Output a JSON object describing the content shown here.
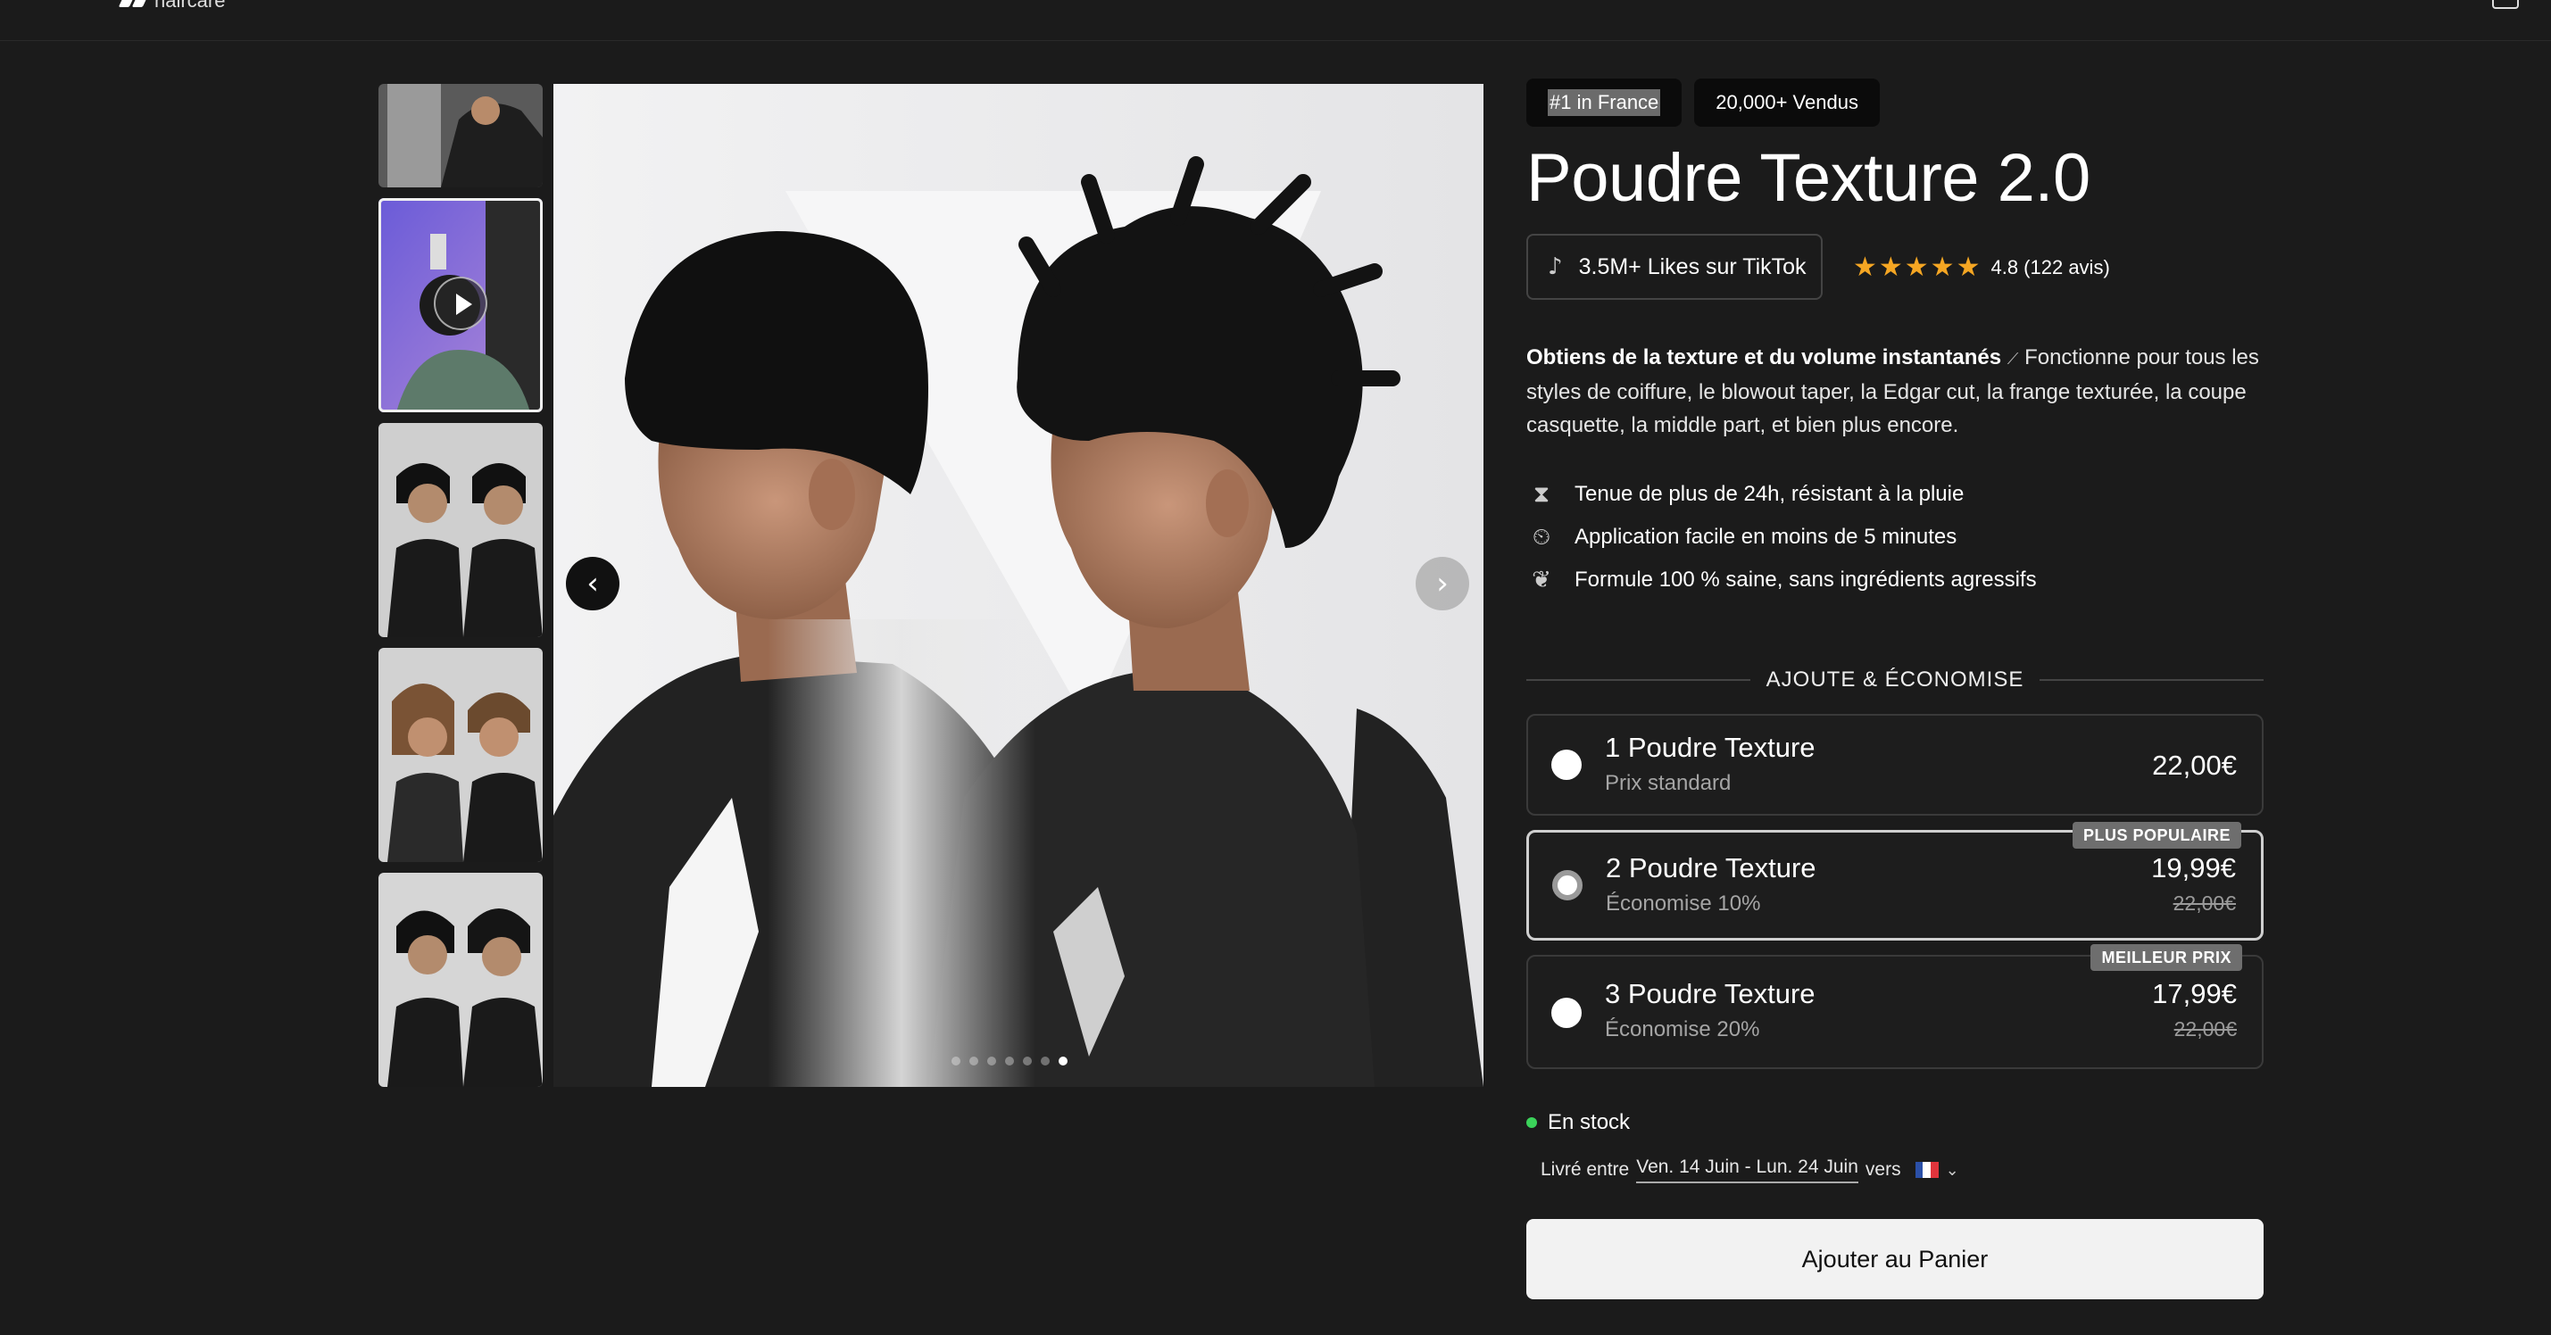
{
  "header": {
    "logo_text": "haircare"
  },
  "gallery": {
    "prev_icon": "chevron-left-icon",
    "next_icon": "chevron-right-icon",
    "dots_count": 7,
    "active_dot": 6
  },
  "product": {
    "badges": [
      "#1 in France",
      "20,000+ Vendus"
    ],
    "title": "Poudre Texture 2.0",
    "tiktok_label": "3.5M+ Likes sur TikTok",
    "rating_value": "4.8 (122 avis)",
    "stars": "★★★★★",
    "description_bold": "Obtiens de la texture et du volume instantanés",
    "description_rest": " Fonctionne pour tous les styles de coiffure, le blowout taper, la Edgar cut, la frange texturée, la coupe casquette, la middle part, et bien plus encore.",
    "features": [
      {
        "icon": "hourglass-icon",
        "text": "Tenue de plus de 24h, résistant à la pluie"
      },
      {
        "icon": "fast-clock-icon",
        "text": "Application facile en moins de 5 minutes"
      },
      {
        "icon": "leaf-icon",
        "text": "Formule 100 % saine, sans ingrédients agressifs"
      }
    ]
  },
  "bundle": {
    "section_title": "AJOUTE & ÉCONOMISE",
    "options": [
      {
        "name": "1 Poudre Texture",
        "sub": "Prix standard",
        "price": "22,00€",
        "old_price": "",
        "ribbon": "",
        "selected": false
      },
      {
        "name": "2 Poudre Texture",
        "sub": "Économise 10%",
        "price": "19,99€",
        "old_price": "22,00€",
        "ribbon": "PLUS POPULAIRE",
        "selected": true
      },
      {
        "name": "3 Poudre Texture",
        "sub": "Économise 20%",
        "price": "17,99€",
        "old_price": "22,00€",
        "ribbon": "MEILLEUR PRIX",
        "selected": false
      }
    ]
  },
  "stock": {
    "label": "En stock"
  },
  "delivery": {
    "prefix": "Livré entre",
    "dates": "Ven. 14 Juin - Lun. 24 Juin",
    "suffix": "vers"
  },
  "cta": {
    "label": "Ajouter au Panier"
  }
}
